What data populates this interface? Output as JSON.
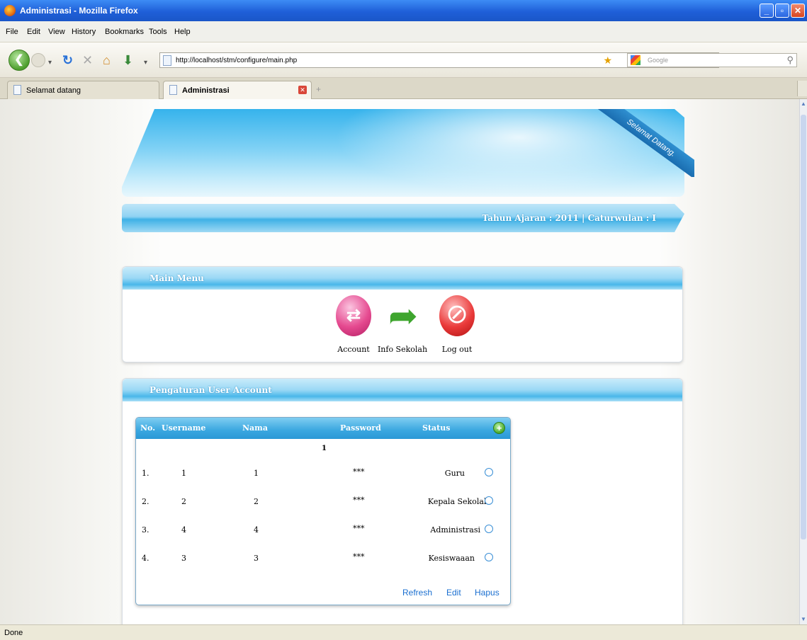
{
  "window": {
    "title": "Administrasi - Mozilla Firefox",
    "min": "_",
    "max": "▫",
    "close": "✕"
  },
  "menu": [
    "File",
    "Edit",
    "View",
    "History",
    "Bookmarks",
    "Tools",
    "Help"
  ],
  "nav": {
    "url": "http://localhost/stm/configure/main.php",
    "search_placeholder": "Google"
  },
  "tabs": [
    {
      "label": "Selamat datang"
    },
    {
      "label": "Administrasi"
    }
  ],
  "banner": {
    "ribbon": "Selamat Datang.",
    "tahun": "Tahun Ajaran : 2011 | Caturwulan : I"
  },
  "main_menu": {
    "title": "Main Menu",
    "items": [
      {
        "label": "Account",
        "icon": "account-icon"
      },
      {
        "label": "Info Sekolah",
        "icon": "arrow-right-icon"
      },
      {
        "label": "Log out",
        "icon": "no-entry-icon"
      }
    ]
  },
  "user_account": {
    "title": "Pengaturan User Account",
    "headers": [
      "No.",
      "Username",
      "Nama",
      "Password",
      "Status"
    ],
    "page": "1",
    "rows": [
      {
        "no": "1.",
        "username": "1",
        "nama": "1",
        "password": "***",
        "status": "Guru"
      },
      {
        "no": "2.",
        "username": "2",
        "nama": "2",
        "password": "***",
        "status": "Kepala Sekolah"
      },
      {
        "no": "3.",
        "username": "4",
        "nama": "4",
        "password": "***",
        "status": "Administrasi"
      },
      {
        "no": "4.",
        "username": "3",
        "nama": "3",
        "password": "***",
        "status": "Kesiswaaan"
      }
    ],
    "actions": {
      "refresh": "Refresh",
      "edit": "Edit",
      "hapus": "Hapus"
    }
  },
  "status": "Done"
}
